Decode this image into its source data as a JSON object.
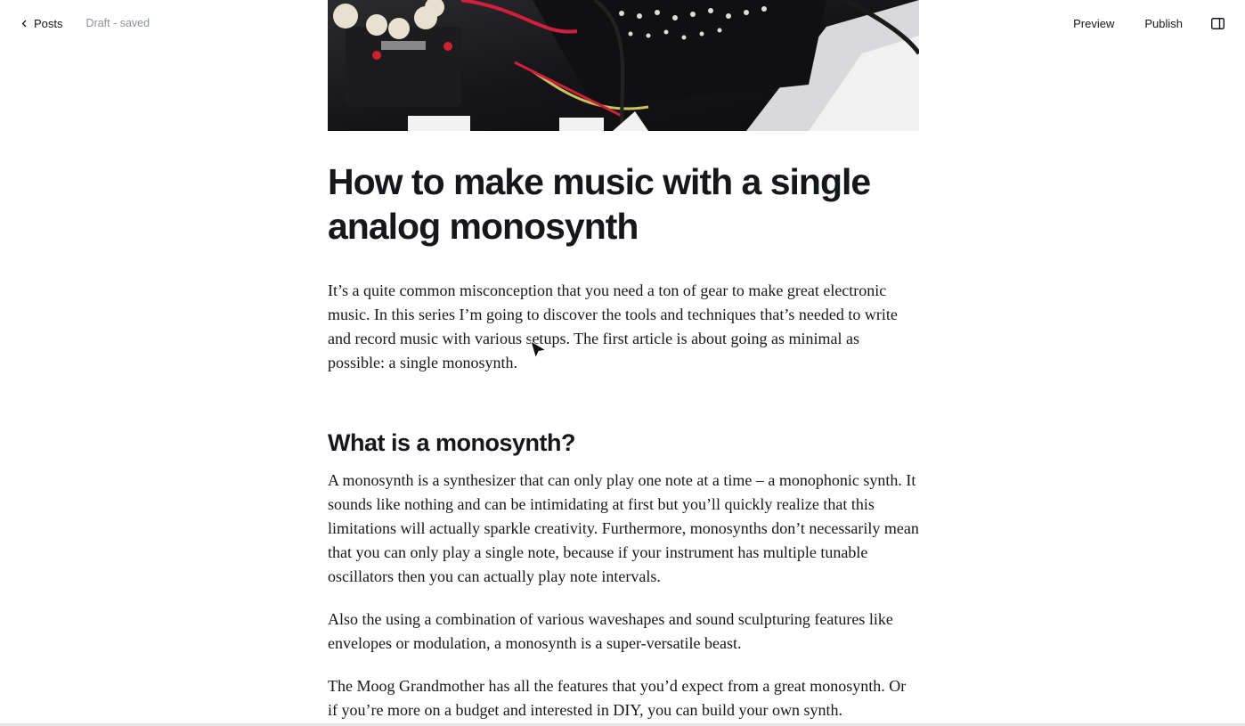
{
  "topbar": {
    "back_label": "Posts",
    "status": "Draft - saved",
    "preview_label": "Preview",
    "publish_label": "Publish",
    "sidebar_toggle_icon": "sidebar-icon"
  },
  "post": {
    "feature_image_icon": "synth-photo",
    "title": "How to make music with a single analog monosynth",
    "paragraphs": [
      "It’s a quite common misconception that you need a ton of gear to make great electronic music. In this series I’m going to discover the tools and techniques that’s needed to write and record music with various setups. The first article is about going as minimal as possible: a single monosynth.",
      "A monosynth is a synthesizer that can only play one note at a time – a monophonic synth. It sounds like nothing and can be intimidating at first but you’ll quickly realize that this limitations will actually sparkle creativity. Furthermore, monosynths don’t necessarily mean that you can only play a single note, because if your instrument has multiple tunable oscillators then you can actually play note intervals.",
      "Also the using a combination of various waveshapes and sound sculpturing features like envelopes or modulation, a monosynth is a super-versatile beast.",
      "The Moog Grandmother has all the features that you’d expect from a great monosynth. Or if you’re more on a budget and interested in DIY, you can build your own synth."
    ],
    "heading": "What is a monosynth?"
  }
}
